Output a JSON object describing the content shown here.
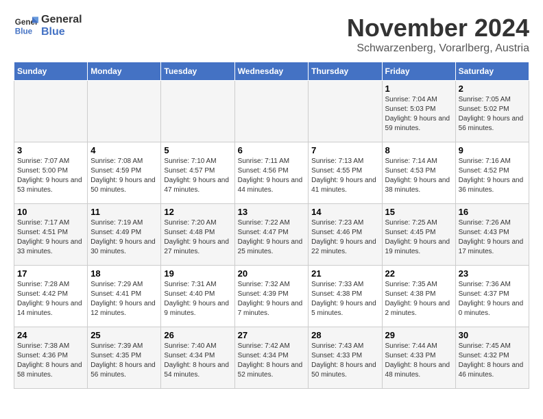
{
  "logo": {
    "line1": "General",
    "line2": "Blue"
  },
  "title": "November 2024",
  "subtitle": "Schwarzenberg, Vorarlberg, Austria",
  "days_of_week": [
    "Sunday",
    "Monday",
    "Tuesday",
    "Wednesday",
    "Thursday",
    "Friday",
    "Saturday"
  ],
  "weeks": [
    [
      {
        "day": "",
        "info": ""
      },
      {
        "day": "",
        "info": ""
      },
      {
        "day": "",
        "info": ""
      },
      {
        "day": "",
        "info": ""
      },
      {
        "day": "",
        "info": ""
      },
      {
        "day": "1",
        "info": "Sunrise: 7:04 AM\nSunset: 5:03 PM\nDaylight: 9 hours and 59 minutes."
      },
      {
        "day": "2",
        "info": "Sunrise: 7:05 AM\nSunset: 5:02 PM\nDaylight: 9 hours and 56 minutes."
      }
    ],
    [
      {
        "day": "3",
        "info": "Sunrise: 7:07 AM\nSunset: 5:00 PM\nDaylight: 9 hours and 53 minutes."
      },
      {
        "day": "4",
        "info": "Sunrise: 7:08 AM\nSunset: 4:59 PM\nDaylight: 9 hours and 50 minutes."
      },
      {
        "day": "5",
        "info": "Sunrise: 7:10 AM\nSunset: 4:57 PM\nDaylight: 9 hours and 47 minutes."
      },
      {
        "day": "6",
        "info": "Sunrise: 7:11 AM\nSunset: 4:56 PM\nDaylight: 9 hours and 44 minutes."
      },
      {
        "day": "7",
        "info": "Sunrise: 7:13 AM\nSunset: 4:55 PM\nDaylight: 9 hours and 41 minutes."
      },
      {
        "day": "8",
        "info": "Sunrise: 7:14 AM\nSunset: 4:53 PM\nDaylight: 9 hours and 38 minutes."
      },
      {
        "day": "9",
        "info": "Sunrise: 7:16 AM\nSunset: 4:52 PM\nDaylight: 9 hours and 36 minutes."
      }
    ],
    [
      {
        "day": "10",
        "info": "Sunrise: 7:17 AM\nSunset: 4:51 PM\nDaylight: 9 hours and 33 minutes."
      },
      {
        "day": "11",
        "info": "Sunrise: 7:19 AM\nSunset: 4:49 PM\nDaylight: 9 hours and 30 minutes."
      },
      {
        "day": "12",
        "info": "Sunrise: 7:20 AM\nSunset: 4:48 PM\nDaylight: 9 hours and 27 minutes."
      },
      {
        "day": "13",
        "info": "Sunrise: 7:22 AM\nSunset: 4:47 PM\nDaylight: 9 hours and 25 minutes."
      },
      {
        "day": "14",
        "info": "Sunrise: 7:23 AM\nSunset: 4:46 PM\nDaylight: 9 hours and 22 minutes."
      },
      {
        "day": "15",
        "info": "Sunrise: 7:25 AM\nSunset: 4:45 PM\nDaylight: 9 hours and 19 minutes."
      },
      {
        "day": "16",
        "info": "Sunrise: 7:26 AM\nSunset: 4:43 PM\nDaylight: 9 hours and 17 minutes."
      }
    ],
    [
      {
        "day": "17",
        "info": "Sunrise: 7:28 AM\nSunset: 4:42 PM\nDaylight: 9 hours and 14 minutes."
      },
      {
        "day": "18",
        "info": "Sunrise: 7:29 AM\nSunset: 4:41 PM\nDaylight: 9 hours and 12 minutes."
      },
      {
        "day": "19",
        "info": "Sunrise: 7:31 AM\nSunset: 4:40 PM\nDaylight: 9 hours and 9 minutes."
      },
      {
        "day": "20",
        "info": "Sunrise: 7:32 AM\nSunset: 4:39 PM\nDaylight: 9 hours and 7 minutes."
      },
      {
        "day": "21",
        "info": "Sunrise: 7:33 AM\nSunset: 4:38 PM\nDaylight: 9 hours and 5 minutes."
      },
      {
        "day": "22",
        "info": "Sunrise: 7:35 AM\nSunset: 4:38 PM\nDaylight: 9 hours and 2 minutes."
      },
      {
        "day": "23",
        "info": "Sunrise: 7:36 AM\nSunset: 4:37 PM\nDaylight: 9 hours and 0 minutes."
      }
    ],
    [
      {
        "day": "24",
        "info": "Sunrise: 7:38 AM\nSunset: 4:36 PM\nDaylight: 8 hours and 58 minutes."
      },
      {
        "day": "25",
        "info": "Sunrise: 7:39 AM\nSunset: 4:35 PM\nDaylight: 8 hours and 56 minutes."
      },
      {
        "day": "26",
        "info": "Sunrise: 7:40 AM\nSunset: 4:34 PM\nDaylight: 8 hours and 54 minutes."
      },
      {
        "day": "27",
        "info": "Sunrise: 7:42 AM\nSunset: 4:34 PM\nDaylight: 8 hours and 52 minutes."
      },
      {
        "day": "28",
        "info": "Sunrise: 7:43 AM\nSunset: 4:33 PM\nDaylight: 8 hours and 50 minutes."
      },
      {
        "day": "29",
        "info": "Sunrise: 7:44 AM\nSunset: 4:33 PM\nDaylight: 8 hours and 48 minutes."
      },
      {
        "day": "30",
        "info": "Sunrise: 7:45 AM\nSunset: 4:32 PM\nDaylight: 8 hours and 46 minutes."
      }
    ]
  ]
}
